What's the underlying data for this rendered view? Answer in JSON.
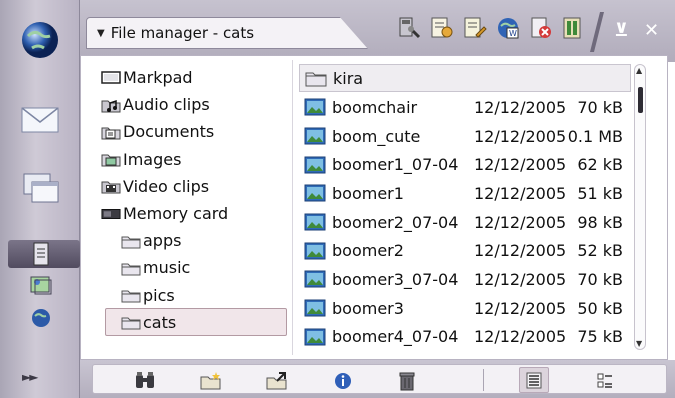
{
  "titlebar": {
    "title": "File manager - cats",
    "menu_arrow": "▼",
    "minimize_label": "⊻",
    "close_label": "✕",
    "toolbar_icons": [
      "disk-tools-icon",
      "details-icon",
      "edit-icon",
      "web-icon",
      "uninstall-icon",
      "install-icon"
    ]
  },
  "taskbar": {
    "items": [
      "globe-icon",
      "mail-icon",
      "windows-icon",
      "file-manager-icon",
      "picture-icon",
      "globe-small-icon"
    ],
    "more_label": "►►"
  },
  "tree": {
    "items": [
      {
        "label": "Markpad",
        "icon": "device-icon"
      },
      {
        "label": "Audio clips",
        "icon": "audio-folder-icon"
      },
      {
        "label": "Documents",
        "icon": "documents-folder-icon"
      },
      {
        "label": "Images",
        "icon": "images-folder-icon"
      },
      {
        "label": "Video clips",
        "icon": "video-folder-icon"
      },
      {
        "label": "Memory card",
        "icon": "memory-card-icon"
      },
      {
        "label": "apps",
        "icon": "folder-icon"
      },
      {
        "label": "music",
        "icon": "folder-icon"
      },
      {
        "label": "pics",
        "icon": "folder-icon"
      },
      {
        "label": "cats",
        "icon": "folder-icon",
        "selected": true
      }
    ]
  },
  "files": {
    "rows": [
      {
        "name": "kira",
        "date": "",
        "size": "",
        "type": "folder"
      },
      {
        "name": "boomchair",
        "date": "12/12/2005",
        "size": "70 kB",
        "type": "image"
      },
      {
        "name": "boom_cute",
        "date": "12/12/2005",
        "size": "0.1 MB",
        "type": "image"
      },
      {
        "name": "boomer1_07-04",
        "date": "12/12/2005",
        "size": "62 kB",
        "type": "image"
      },
      {
        "name": "boomer1",
        "date": "12/12/2005",
        "size": "51 kB",
        "type": "image"
      },
      {
        "name": "boomer2_07-04",
        "date": "12/12/2005",
        "size": "98 kB",
        "type": "image"
      },
      {
        "name": "boomer2",
        "date": "12/12/2005",
        "size": "52 kB",
        "type": "image"
      },
      {
        "name": "boomer3_07-04",
        "date": "12/12/2005",
        "size": "70 kB",
        "type": "image"
      },
      {
        "name": "boomer3",
        "date": "12/12/2005",
        "size": "50 kB",
        "type": "image"
      },
      {
        "name": "boomer4_07-04",
        "date": "12/12/2005",
        "size": "75 kB",
        "type": "image"
      }
    ]
  },
  "scrollbar": {
    "up_arrow": "▲",
    "down_arrow": "▼"
  },
  "commandbar": {
    "buttons": [
      "find-icon",
      "new-folder-icon",
      "move-icon",
      "info-icon",
      "delete-icon",
      "list-view-icon",
      "detail-view-icon"
    ]
  },
  "colors": {
    "selection_bg": "#f1e6ea",
    "chrome": "#b1acbb"
  }
}
